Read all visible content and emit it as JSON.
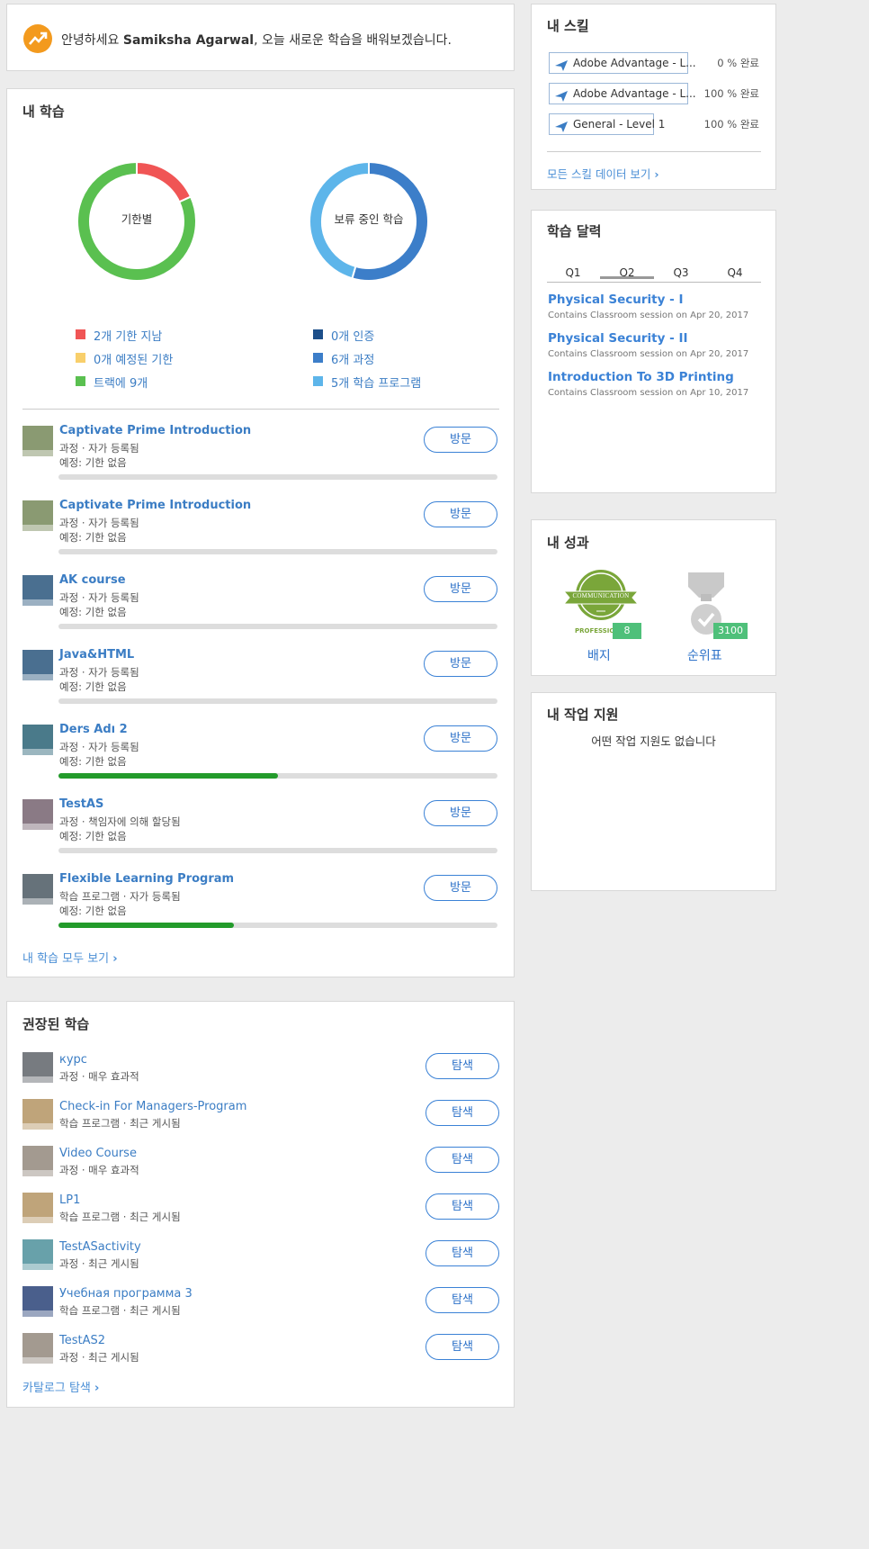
{
  "greeting": {
    "prefix": "안녕하세요 ",
    "name": "Samiksha Agarwal",
    "suffix": ", 오늘 새로운 학습을 배워보겠습니다."
  },
  "my_learning": {
    "title": "내 학습",
    "donut1": {
      "label": "기한별",
      "segments": [
        {
          "value": 2,
          "color": "#f05555"
        },
        {
          "value": 0,
          "color": "#f8cf6b"
        },
        {
          "value": 9,
          "color": "#5ac050"
        }
      ]
    },
    "donut2": {
      "label": "보류 중인 학습",
      "segments": [
        {
          "value": 0,
          "color": "#1d4f8a"
        },
        {
          "value": 6,
          "color": "#3c7ec9"
        },
        {
          "value": 5,
          "color": "#5db5ea"
        }
      ]
    },
    "legend_left": [
      {
        "text": "2개 기한 지남",
        "color": "#f05555"
      },
      {
        "text": "0개 예정된 기한",
        "color": "#f8cf6b"
      },
      {
        "text": "트랙에 9개",
        "color": "#5ac050"
      }
    ],
    "legend_right": [
      {
        "text": "0개 인증",
        "color": "#1d4f8a"
      },
      {
        "text": "6개 과정",
        "color": "#3c7ec9"
      },
      {
        "text": "5개 학습 프로그램",
        "color": "#5db5ea"
      }
    ],
    "items": [
      {
        "title": "Captivate Prime Introduction",
        "type": "과정 · 자가 등록됨",
        "due": "예정: 기한 없음",
        "progress": 0,
        "thumb": "#8a9a72",
        "button": "방문"
      },
      {
        "title": "Captivate Prime Introduction",
        "type": "과정 · 자가 등록됨",
        "due": "예정: 기한 없음",
        "progress": 0,
        "thumb": "#8a9a72",
        "button": "방문"
      },
      {
        "title": "AK course",
        "type": "과정 · 자가 등록됨",
        "due": "예정: 기한 없음",
        "progress": 0,
        "thumb": "#4a6f90",
        "button": "방문"
      },
      {
        "title": "Java&HTML",
        "type": "과정 · 자가 등록됨",
        "due": "예정: 기한 없음",
        "progress": 0,
        "thumb": "#4a6f90",
        "button": "방문"
      },
      {
        "title": "Ders Adı 2",
        "type": "과정 · 자가 등록됨",
        "due": "예정: 기한 없음",
        "progress": 50,
        "thumb": "#4a7a8a",
        "button": "방문"
      },
      {
        "title": "TestAS",
        "type": "과정 · 책임자에 의해 할당됨",
        "due": "예정: 기한 없음",
        "progress": 0,
        "thumb": "#8a7a85",
        "button": "방문"
      },
      {
        "title": "Flexible Learning Program",
        "type": "학습 프로그램 · 자가 등록됨",
        "due": "예정: 기한 없음",
        "progress": 40,
        "thumb": "#66727a",
        "button": "방문"
      }
    ],
    "view_all": "내 학습 모두 보기"
  },
  "recommended": {
    "title": "권장된 학습",
    "items": [
      {
        "title": "курс",
        "meta": "과정 · 매우 효과적",
        "thumb": "#777b80",
        "button": "탐색"
      },
      {
        "title": "Check-in For Managers-Program",
        "meta": "학습 프로그램 · 최근 게시됨",
        "thumb": "#bfa47a",
        "button": "탐색"
      },
      {
        "title": "Video Course",
        "meta": "과정 · 매우 효과적",
        "thumb": "#a39a90",
        "button": "탐색"
      },
      {
        "title": "LP1",
        "meta": "학습 프로그램 · 최근 게시됨",
        "thumb": "#bfa47a",
        "button": "탐색"
      },
      {
        "title": "TestASactivity",
        "meta": "과정 · 최근 게시됨",
        "thumb": "#68a1aa",
        "button": "탐색"
      },
      {
        "title": "Учебная программа 3",
        "meta": "학습 프로그램 · 최근 게시됨",
        "thumb": "#4a5f8c",
        "button": "탐색"
      },
      {
        "title": "TestAS2",
        "meta": "과정 · 최근 게시됨",
        "thumb": "#a39a90",
        "button": "탐색"
      }
    ],
    "catalog_link": "카탈로그 탐색"
  },
  "skills": {
    "title": "내 스킬",
    "items": [
      {
        "name": "Adobe Advantage - L...",
        "pct": "0 % 완료"
      },
      {
        "name": "Adobe Advantage - L...",
        "pct": "100 % 완료"
      },
      {
        "name": "General - Level 1",
        "pct": "100 % 완료"
      }
    ],
    "view_all": "모든 스킬 데이터 보기"
  },
  "calendar": {
    "title": "학습 달력",
    "tabs": [
      "Q1",
      "Q2",
      "Q3",
      "Q4"
    ],
    "active_tab": "Q2",
    "items": [
      {
        "title": "Physical Security - I",
        "sub": "Contains Classroom session on Apr 20, 2017"
      },
      {
        "title": "Physical Security - II",
        "sub": "Contains Classroom session on Apr 20, 2017"
      },
      {
        "title": "Introduction To 3D Printing",
        "sub": "Contains Classroom session on Apr 10, 2017"
      }
    ]
  },
  "achievements": {
    "title": "내 성과",
    "badge_ribbon_text": "COMMUNICATION",
    "badge_bottom_text": "PROFESSIO",
    "badge_count": "8",
    "badge_label": "배지",
    "rank_value": "3100",
    "rank_label": "순위표"
  },
  "job_aids": {
    "title": "내 작업 지원",
    "empty": "어떤 작업 지원도 없습니다"
  },
  "colors": {
    "accent": "#3b82d6",
    "progress": "#239b2b",
    "badge_green": "#7aa63a",
    "count_badge": "#4fc07a"
  }
}
